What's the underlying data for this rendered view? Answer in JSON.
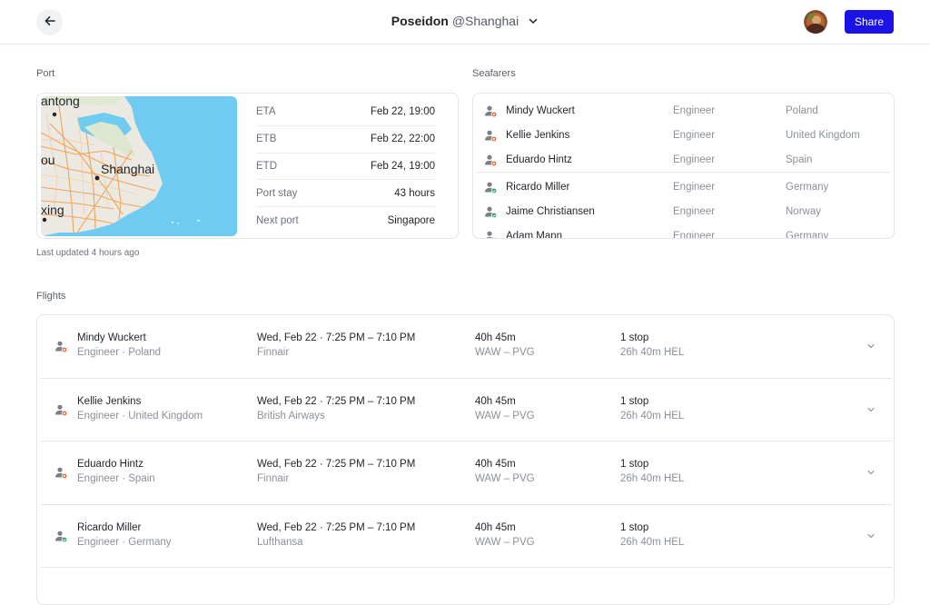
{
  "header": {
    "vessel": "Poseidon",
    "port": "@Shanghai",
    "share_label": "Share"
  },
  "port": {
    "label": "Port",
    "map_labels": {
      "top": "antong",
      "city": "Shanghai",
      "left": "ou",
      "bottom": "xing"
    },
    "rows": [
      {
        "key": "ETA",
        "value": "Feb 22, 19:00"
      },
      {
        "key": "ETB",
        "value": "Feb 22, 22:00"
      },
      {
        "key": "ETD",
        "value": "Feb 24, 19:00"
      },
      {
        "key": "Port stay",
        "value": "43 hours"
      },
      {
        "key": "Next port",
        "value": "Singapore"
      }
    ],
    "last_updated": "Last updated 4 hours ago"
  },
  "seafarers": {
    "label": "Seafarers",
    "items": [
      {
        "name": "Mindy Wuckert",
        "role": "Engineer",
        "country": "Poland",
        "status": "off"
      },
      {
        "name": "Kellie Jenkins",
        "role": "Engineer",
        "country": "United Kingdom",
        "status": "off"
      },
      {
        "name": "Eduardo Hintz",
        "role": "Engineer",
        "country": "Spain",
        "status": "off"
      },
      {
        "name": "Ricardo Miller",
        "role": "Engineer",
        "country": "Germany",
        "status": "on"
      },
      {
        "name": "Jaime Christiansen",
        "role": "Engineer",
        "country": "Norway",
        "status": "on"
      },
      {
        "name": "Adam Mann",
        "role": "Engineer",
        "country": "Germany",
        "status": "on"
      }
    ]
  },
  "flights": {
    "label": "Flights",
    "items": [
      {
        "name": "Mindy Wuckert",
        "sub": "Engineer · Poland",
        "time": "Wed, Feb 22 · 7:25 PM – 7:10 PM",
        "airline": "Finnair",
        "duration": "40h 45m",
        "route": "WAW – PVG",
        "stops": "1 stop",
        "layover": "26h 40m HEL",
        "status": "off"
      },
      {
        "name": "Kellie Jenkins",
        "sub": "Engineer · United Kingdom",
        "time": "Wed, Feb 22 · 7:25 PM – 7:10 PM",
        "airline": "British Airways",
        "duration": "40h 45m",
        "route": "WAW – PVG",
        "stops": "1 stop",
        "layover": "26h 40m HEL",
        "status": "off"
      },
      {
        "name": "Eduardo Hintz",
        "sub": "Engineer · Spain",
        "time": "Wed, Feb 22 · 7:25 PM – 7:10 PM",
        "airline": "Finnair",
        "duration": "40h 45m",
        "route": "WAW – PVG",
        "stops": "1 stop",
        "layover": "26h 40m HEL",
        "status": "off"
      },
      {
        "name": "Ricardo Miller",
        "sub": "Engineer · Germany",
        "time": "Wed, Feb 22 · 7:25 PM – 7:10 PM",
        "airline": "Lufthansa",
        "duration": "40h 45m",
        "route": "WAW – PVG",
        "stops": "1 stop",
        "layover": "26h 40m HEL",
        "status": "on"
      }
    ]
  },
  "colors": {
    "accent": "#1a12e6",
    "status_off": "#e8622c",
    "status_on": "#2e9e6a",
    "water": "#6fcbef",
    "land": "#ece9e2",
    "roads": "#f0a55a"
  }
}
